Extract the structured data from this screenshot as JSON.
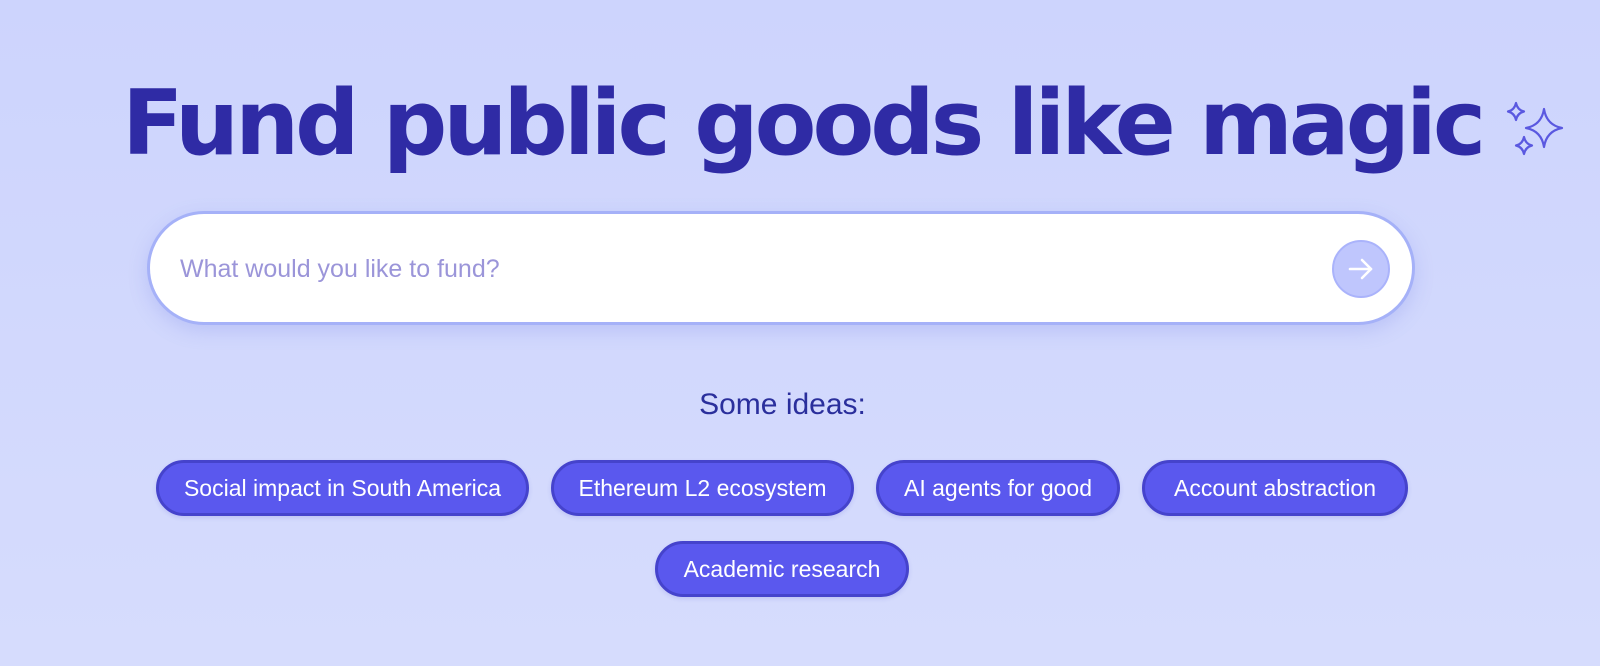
{
  "hero": {
    "title": "Fund public goods like magic",
    "decoration_icon": "sparkles-icon"
  },
  "search": {
    "placeholder": "What would you like to fund?",
    "value": "",
    "submit_icon": "arrow-right-icon"
  },
  "ideas": {
    "label": "Some ideas:",
    "chips": [
      {
        "label": "Social impact in South America"
      },
      {
        "label": "Ethereum L2 ecosystem"
      },
      {
        "label": "AI agents for good"
      },
      {
        "label": "Account abstraction"
      },
      {
        "label": "Academic research"
      }
    ]
  },
  "colors": {
    "background": "#cdd4fd",
    "title": "#2f2ba5",
    "chip": "#5a58ee",
    "chip_border": "#4543cc",
    "search_border": "#a5b1f8",
    "submit_button": "#bfc6fd"
  }
}
